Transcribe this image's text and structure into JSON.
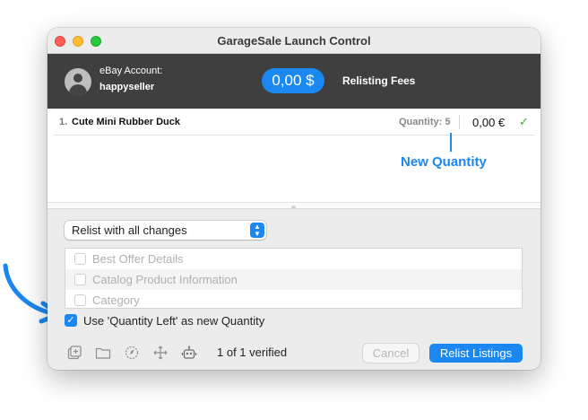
{
  "window": {
    "title": "GarageSale Launch Control"
  },
  "header": {
    "account_label": "eBay Account:",
    "account_name": "happyseller",
    "fee_amount": "0,00 $",
    "fee_label": "Relisting Fees"
  },
  "listings": [
    {
      "number": "1.",
      "title": "Cute Mini Rubber Duck",
      "quantity": "Quantity: 5",
      "price": "0,00 €",
      "status": "✓"
    }
  ],
  "annotation": {
    "callout": "New Quantity"
  },
  "relist_mode": {
    "selected": "Relist with all changes"
  },
  "options": [
    {
      "label": "Best Offer Details",
      "checked": false
    },
    {
      "label": "Catalog Product Information",
      "checked": false
    },
    {
      "label": "Category",
      "checked": false
    }
  ],
  "quantity_option": {
    "label": "Use 'Quantity Left' as new Quantity",
    "checked": true
  },
  "footer": {
    "status": "1 of 1 verified",
    "cancel_label": "Cancel",
    "relist_label": "Relist Listings"
  },
  "colors": {
    "accent": "#1b87f0",
    "header_bg": "#3f3f3f",
    "check_green": "#3ea33b"
  }
}
